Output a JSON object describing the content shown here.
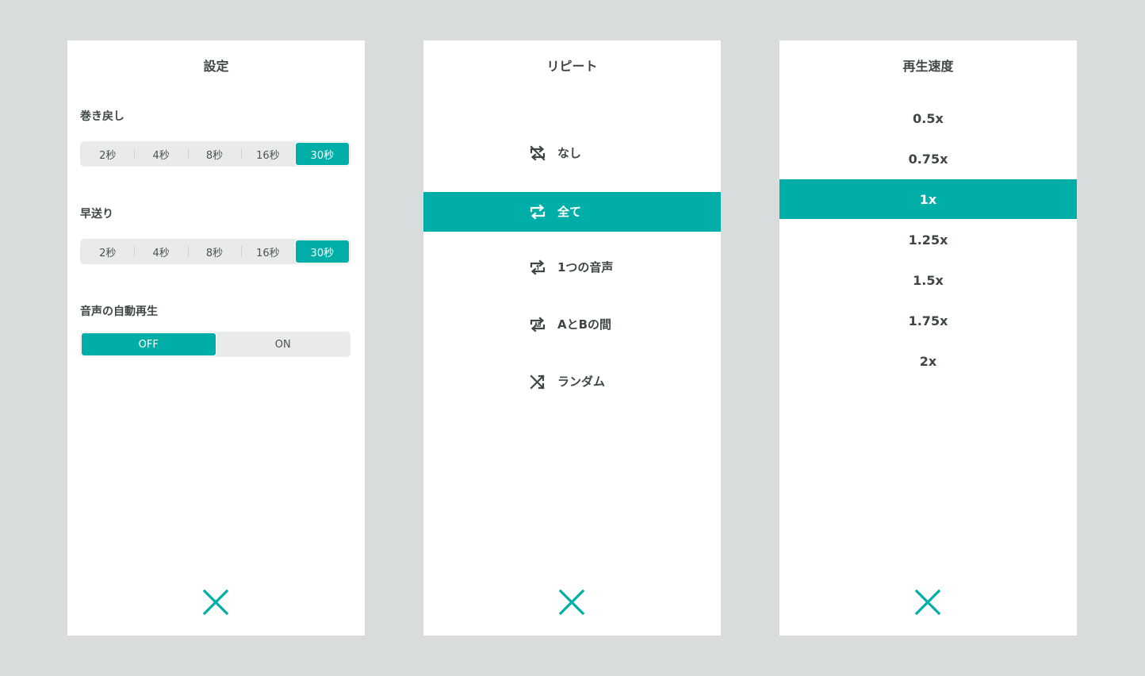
{
  "colors": {
    "background": "#d8dcdc",
    "panel": "#ffffff",
    "accent": "#00aea8",
    "text": "#3e4646",
    "segment_bg": "#e9ebeb"
  },
  "settings": {
    "title": "設定",
    "rewind": {
      "label": "巻き戻し",
      "options": [
        "2秒",
        "4秒",
        "8秒",
        "16秒",
        "30秒"
      ],
      "selected": "30秒"
    },
    "forward": {
      "label": "早送り",
      "options": [
        "2秒",
        "4秒",
        "8秒",
        "16秒",
        "30秒"
      ],
      "selected": "30秒"
    },
    "autoplay": {
      "label": "音声の自動再生",
      "off_label": "OFF",
      "on_label": "ON",
      "selected": "OFF"
    },
    "close_icon": "close-icon"
  },
  "repeat": {
    "title": "リピート",
    "items": [
      {
        "label": "なし",
        "icon": "repeat-off-icon"
      },
      {
        "label": "全て",
        "icon": "repeat-all-icon"
      },
      {
        "label": "1つの音声",
        "icon": "repeat-one-icon"
      },
      {
        "label": "AとBの間",
        "icon": "repeat-ab-icon"
      },
      {
        "label": "ランダム",
        "icon": "shuffle-icon"
      }
    ],
    "selected": "全て",
    "close_icon": "close-icon"
  },
  "speed": {
    "title": "再生速度",
    "items": [
      "0.5x",
      "0.75x",
      "1x",
      "1.25x",
      "1.5x",
      "1.75x",
      "2x"
    ],
    "selected": "1x",
    "close_icon": "close-icon"
  }
}
